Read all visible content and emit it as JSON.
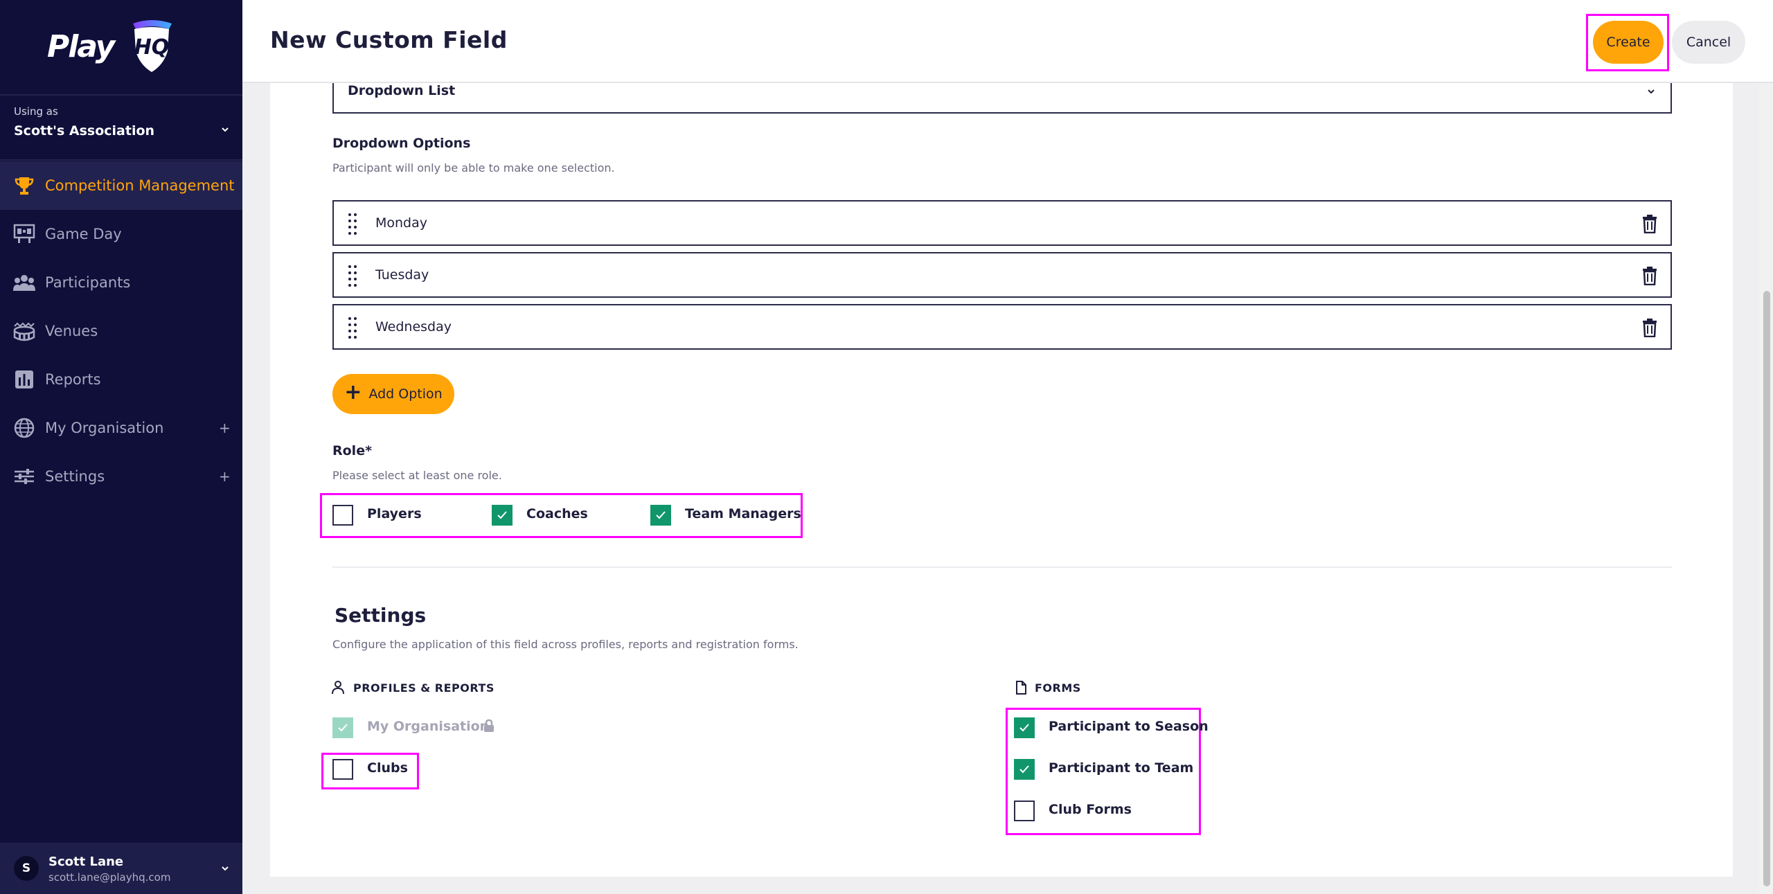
{
  "sidebar": {
    "logo_text": "Play",
    "logo_badge": "HQ",
    "using_as": "Using as",
    "org_name": "Scott's Association",
    "nav": [
      {
        "label": "Competition Management",
        "icon": "trophy-icon",
        "active": true
      },
      {
        "label": "Game Day",
        "icon": "scoreboard-icon"
      },
      {
        "label": "Participants",
        "icon": "people-icon"
      },
      {
        "label": "Venues",
        "icon": "stadium-icon"
      },
      {
        "label": "Reports",
        "icon": "chart-icon"
      },
      {
        "label": "My Organisation",
        "icon": "globe-icon",
        "expand": "+"
      },
      {
        "label": "Settings",
        "icon": "sliders-icon",
        "expand": "+"
      }
    ],
    "user": {
      "initial": "S",
      "name": "Scott Lane",
      "email": "scott.lane@playhq.com"
    }
  },
  "header": {
    "title": "New Custom Field",
    "create_label": "Create",
    "cancel_label": "Cancel"
  },
  "form": {
    "field_type_value": "Dropdown List",
    "dropdown_options_label": "Dropdown Options",
    "dropdown_options_hint": "Participant will only be able to make one selection.",
    "options": [
      "Monday",
      "Tuesday",
      "Wednesday"
    ],
    "add_option_label": "Add Option",
    "role_label": "Role*",
    "role_hint": "Please select at least one role.",
    "roles": [
      {
        "label": "Players",
        "checked": false
      },
      {
        "label": "Coaches",
        "checked": true
      },
      {
        "label": "Team Managers",
        "checked": true
      }
    ]
  },
  "settings": {
    "title": "Settings",
    "hint": "Configure the application of this field across profiles, reports and registration forms.",
    "profiles_heading": "PROFILES & REPORTS",
    "profiles": [
      {
        "label": "My Organisation",
        "checked": true,
        "disabled": true
      },
      {
        "label": "Clubs",
        "checked": false
      }
    ],
    "forms_heading": "FORMS",
    "forms": [
      {
        "label": "Participant to Season",
        "checked": true
      },
      {
        "label": "Participant to Team",
        "checked": true
      },
      {
        "label": "Club Forms",
        "checked": false
      }
    ]
  },
  "colors": {
    "sidebar_bg": "#0f0f3a",
    "accent": "#ffa50a",
    "check_green": "#11966b",
    "highlight": "#ff00ff"
  }
}
